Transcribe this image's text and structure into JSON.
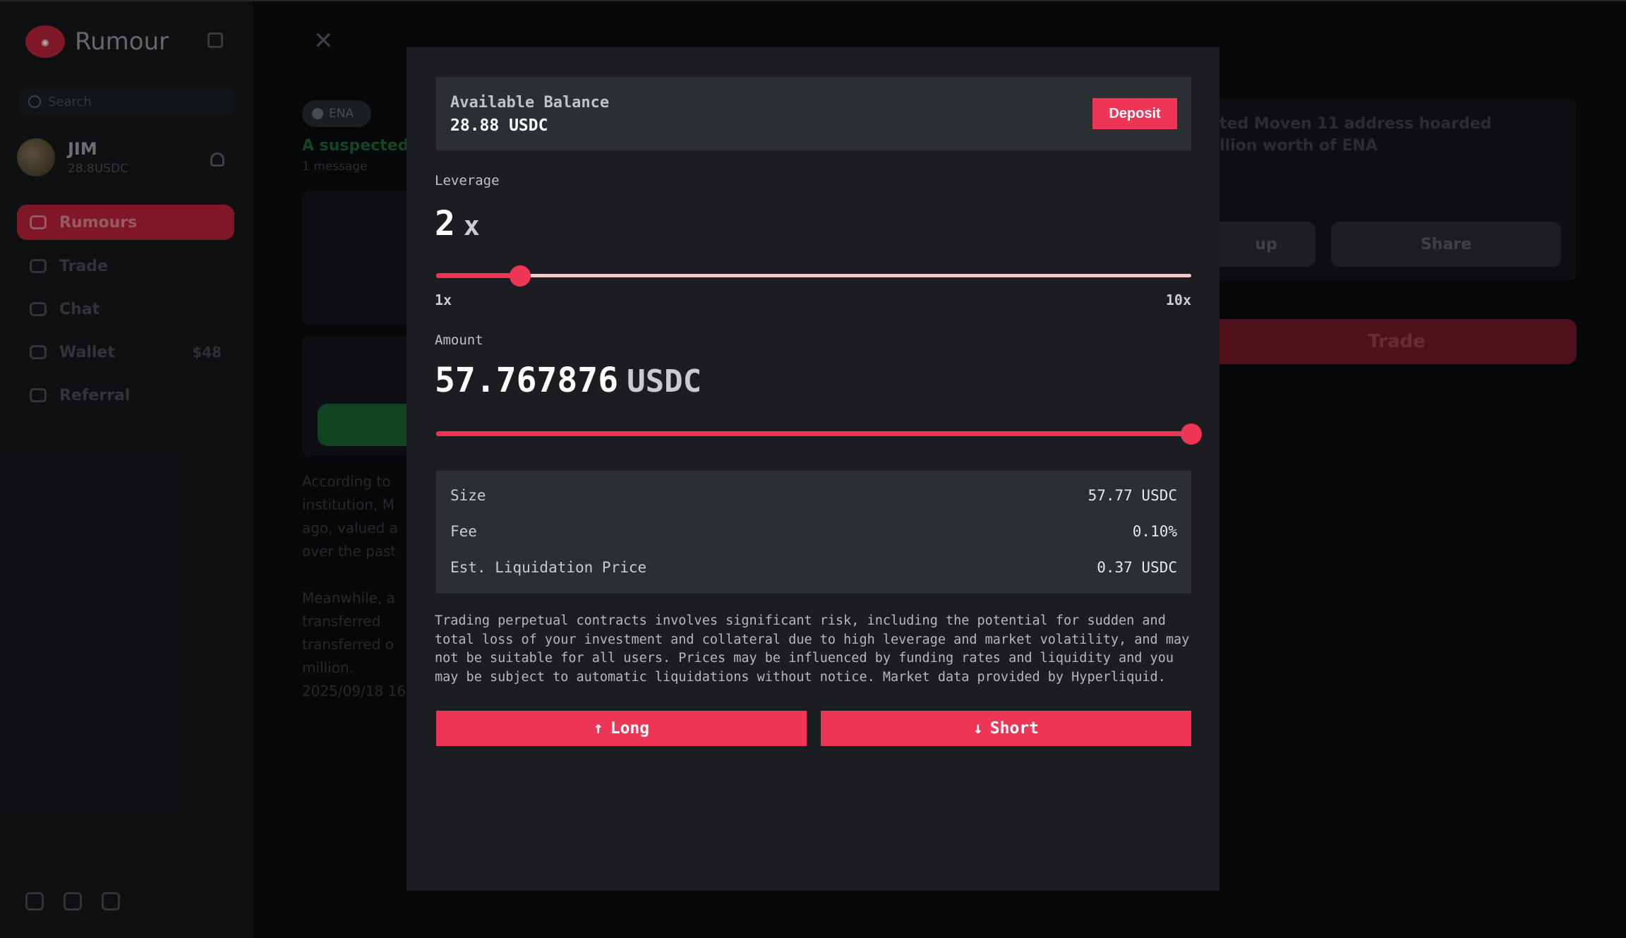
{
  "app": {
    "name": "Rumour",
    "search_placeholder": "Search",
    "user": {
      "name": "JIM",
      "balance": "28.8USDC"
    },
    "nav": [
      {
        "label": "Rumours",
        "icon": "chat-bubble-icon",
        "active": true
      },
      {
        "label": "Trade",
        "icon": "trade-icon"
      },
      {
        "label": "Chat",
        "icon": "chat-icon"
      },
      {
        "label": "Wallet",
        "icon": "wallet-icon",
        "badge": "$48"
      },
      {
        "label": "Referral",
        "icon": "referral-icon"
      }
    ]
  },
  "background": {
    "ticker": "ENA",
    "headline": "A suspected Moven 11 address hoarded",
    "sub": "1 message",
    "paragraph": "According to\ninstitution, M\nago, valued a\nover the past\n\nMeanwhile, a\ntransferred\ntransferred o\nmillion.\n2025/09/18 16",
    "right_text": "ted Moven 11 address hoarded\nllion worth of ENA",
    "right_buttons": [
      "up",
      "Share"
    ],
    "trade_label": "Trade"
  },
  "modal": {
    "balance_label": "Available Balance",
    "balance_value": "28.88 USDC",
    "deposit_label": "Deposit",
    "leverage_label": "Leverage",
    "leverage_value": "2",
    "leverage_unit": "x",
    "leverage_min": "1x",
    "leverage_max": "10x",
    "leverage_fraction": 0.111,
    "amount_label": "Amount",
    "amount_value": "57.767876",
    "amount_unit": "USDC",
    "amount_fraction": 1.0,
    "details": [
      {
        "label": "Size",
        "value": "57.77 USDC"
      },
      {
        "label": "Fee",
        "value": "0.10%"
      },
      {
        "label": "Est. Liquidation Price",
        "value": "0.37 USDC"
      }
    ],
    "disclaimer": "Trading perpetual contracts involves significant risk, including the potential for sudden and total loss of your investment and collateral due to high leverage and market volatility, and may not be suitable for all users. Prices may be influenced by funding rates and liquidity and you may be subject to automatic liquidations without notice. Market data provided by Hyperliquid.",
    "long_label": "Long",
    "short_label": "Short"
  },
  "colors": {
    "accent": "#ee3556",
    "panel": "#2b2e33",
    "modal_bg": "#1b1d21"
  }
}
